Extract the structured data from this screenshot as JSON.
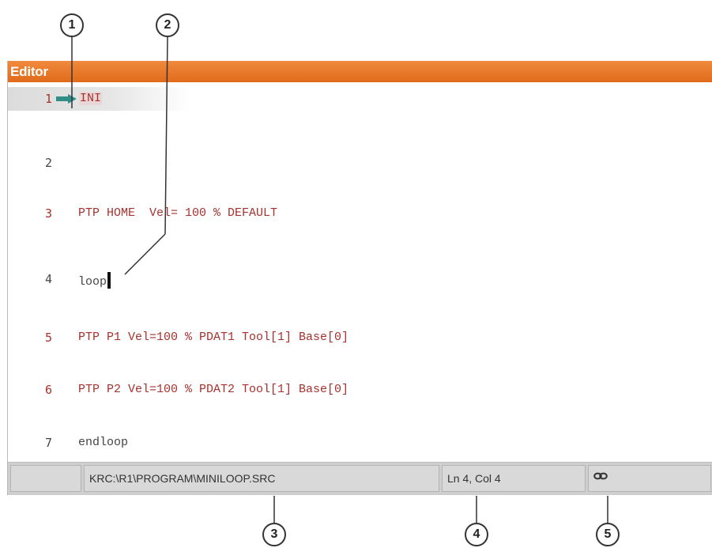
{
  "window": {
    "title": "Editor"
  },
  "editor": {
    "lines": [
      {
        "num": "1",
        "text": "INI"
      },
      {
        "num": "2",
        "text": ""
      },
      {
        "num": "3",
        "text": "PTP HOME  Vel= 100 % DEFAULT"
      },
      {
        "num": "4",
        "text": "loop"
      },
      {
        "num": "5",
        "text": "PTP P1 Vel=100 % PDAT1 Tool[1] Base[0]"
      },
      {
        "num": "6",
        "text": "PTP P2 Vel=100 % PDAT2 Tool[1] Base[0]"
      },
      {
        "num": "7",
        "text": "endloop"
      }
    ],
    "current_line_arrow": "arrow-right-icon",
    "cursor": "text-cursor"
  },
  "status": {
    "path": "KRC:\\R1\\PROGRAM\\MINILOOP.SRC",
    "position": "Ln 4, Col 4",
    "icon": "link-icon"
  },
  "callouts": [
    "1",
    "2",
    "3",
    "4",
    "5"
  ],
  "colors": {
    "title_bar": "#e8742a",
    "code_keyword": "#a8312d",
    "arrow": "#2f8f86",
    "status_bar": "#cfcfcf"
  }
}
